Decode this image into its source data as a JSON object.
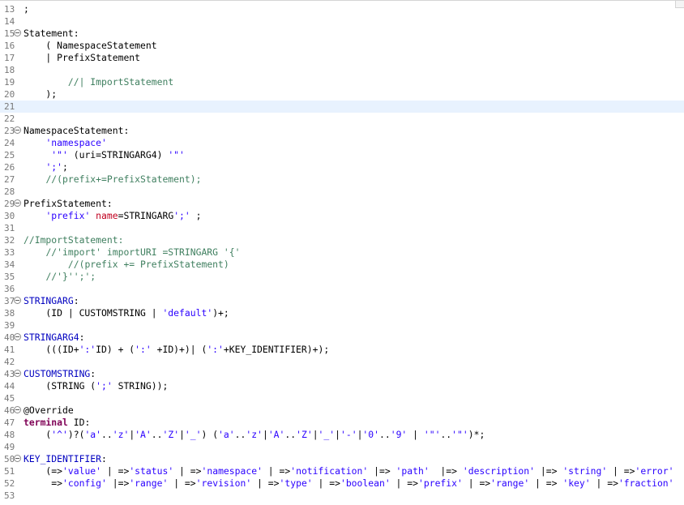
{
  "editor": {
    "colors": {
      "plain": "#000000",
      "string": "#2a00ff",
      "keyword": "#7f0055",
      "comment": "#3f7f5f",
      "cross_reference": "#c0001f",
      "rule_reference": "#0000c0",
      "current_line_background": "#e8f2fe"
    },
    "lines": [
      {
        "no": "13",
        "tokens": [
          {
            "t": "p",
            "v": ";"
          }
        ]
      },
      {
        "no": "14",
        "tokens": []
      },
      {
        "no": "15",
        "fold": true,
        "tokens": [
          {
            "t": "p",
            "v": "Statement:"
          }
        ]
      },
      {
        "no": "16",
        "tokens": [
          {
            "t": "p",
            "v": "    ( NamespaceStatement"
          }
        ]
      },
      {
        "no": "17",
        "tokens": [
          {
            "t": "p",
            "v": "    | PrefixStatement"
          }
        ]
      },
      {
        "no": "18",
        "tokens": []
      },
      {
        "no": "19",
        "tokens": [
          {
            "t": "p",
            "v": "        "
          },
          {
            "t": "c",
            "v": "//| ImportStatement"
          }
        ]
      },
      {
        "no": "20",
        "tokens": [
          {
            "t": "p",
            "v": "    );"
          }
        ]
      },
      {
        "no": "21",
        "current": true,
        "tokens": []
      },
      {
        "no": "22",
        "tokens": []
      },
      {
        "no": "23",
        "fold": true,
        "tokens": [
          {
            "t": "p",
            "v": "NamespaceStatement:"
          }
        ]
      },
      {
        "no": "24",
        "tokens": [
          {
            "t": "p",
            "v": "    "
          },
          {
            "t": "s",
            "v": "'namespace'"
          }
        ]
      },
      {
        "no": "25",
        "tokens": [
          {
            "t": "p",
            "v": "     "
          },
          {
            "t": "s",
            "v": "'\"'"
          },
          {
            "t": "p",
            "v": " (uri=STRINGARG4) "
          },
          {
            "t": "s",
            "v": "'\"'"
          }
        ]
      },
      {
        "no": "26",
        "tokens": [
          {
            "t": "p",
            "v": "    "
          },
          {
            "t": "s",
            "v": "';'"
          },
          {
            "t": "p",
            "v": ";"
          }
        ]
      },
      {
        "no": "27",
        "tokens": [
          {
            "t": "p",
            "v": "    "
          },
          {
            "t": "c",
            "v": "//(prefix+=PrefixStatement);"
          }
        ]
      },
      {
        "no": "28",
        "tokens": []
      },
      {
        "no": "29",
        "fold": true,
        "tokens": [
          {
            "t": "p",
            "v": "PrefixStatement:"
          }
        ]
      },
      {
        "no": "30",
        "tokens": [
          {
            "t": "p",
            "v": "    "
          },
          {
            "t": "s",
            "v": "'prefix'"
          },
          {
            "t": "p",
            "v": " "
          },
          {
            "t": "r",
            "v": "name"
          },
          {
            "t": "p",
            "v": "=STRINGARG"
          },
          {
            "t": "s",
            "v": "';'"
          },
          {
            "t": "p",
            "v": " ;"
          }
        ]
      },
      {
        "no": "31",
        "tokens": []
      },
      {
        "no": "32",
        "tokens": [
          {
            "t": "c",
            "v": "//ImportStatement:"
          }
        ]
      },
      {
        "no": "33",
        "tokens": [
          {
            "t": "p",
            "v": "    "
          },
          {
            "t": "c",
            "v": "//'import' importURI =STRINGARG '{'"
          }
        ]
      },
      {
        "no": "34",
        "tokens": [
          {
            "t": "p",
            "v": "        "
          },
          {
            "t": "c",
            "v": "//(prefix += PrefixStatement)"
          }
        ]
      },
      {
        "no": "35",
        "tokens": [
          {
            "t": "p",
            "v": "    "
          },
          {
            "t": "c",
            "v": "//'}'';';"
          }
        ]
      },
      {
        "no": "36",
        "tokens": []
      },
      {
        "no": "37",
        "fold": true,
        "tokens": [
          {
            "t": "f",
            "v": "STRINGARG"
          },
          {
            "t": "p",
            "v": ":"
          }
        ]
      },
      {
        "no": "38",
        "tokens": [
          {
            "t": "p",
            "v": "    (ID | CUSTOMSTRING | "
          },
          {
            "t": "s",
            "v": "'default'"
          },
          {
            "t": "p",
            "v": ")+;"
          }
        ]
      },
      {
        "no": "39",
        "tokens": []
      },
      {
        "no": "40",
        "fold": true,
        "tokens": [
          {
            "t": "f",
            "v": "STRINGARG4"
          },
          {
            "t": "p",
            "v": ":"
          }
        ]
      },
      {
        "no": "41",
        "tokens": [
          {
            "t": "p",
            "v": "    (((ID+"
          },
          {
            "t": "s",
            "v": "':'"
          },
          {
            "t": "p",
            "v": "ID) + ("
          },
          {
            "t": "s",
            "v": "':'"
          },
          {
            "t": "p",
            "v": " +ID)+)| ("
          },
          {
            "t": "s",
            "v": "':'"
          },
          {
            "t": "p",
            "v": "+KEY_IDENTIFIER)+);"
          }
        ]
      },
      {
        "no": "42",
        "tokens": []
      },
      {
        "no": "43",
        "fold": true,
        "tokens": [
          {
            "t": "f",
            "v": "CUSTOMSTRING"
          },
          {
            "t": "p",
            "v": ":"
          }
        ]
      },
      {
        "no": "44",
        "tokens": [
          {
            "t": "p",
            "v": "    (STRING ("
          },
          {
            "t": "s",
            "v": "';'"
          },
          {
            "t": "p",
            "v": " STRING));"
          }
        ]
      },
      {
        "no": "45",
        "tokens": []
      },
      {
        "no": "46",
        "fold": true,
        "tokens": [
          {
            "t": "p",
            "v": "@Override"
          }
        ]
      },
      {
        "no": "47",
        "tokens": [
          {
            "t": "k",
            "v": "terminal"
          },
          {
            "t": "p",
            "v": " ID:"
          }
        ]
      },
      {
        "no": "48",
        "tokens": [
          {
            "t": "p",
            "v": "    ("
          },
          {
            "t": "s",
            "v": "'^'"
          },
          {
            "t": "p",
            "v": ")?("
          },
          {
            "t": "s",
            "v": "'a'"
          },
          {
            "t": "p",
            "v": ".."
          },
          {
            "t": "s",
            "v": "'z'"
          },
          {
            "t": "p",
            "v": "|"
          },
          {
            "t": "s",
            "v": "'A'"
          },
          {
            "t": "p",
            "v": ".."
          },
          {
            "t": "s",
            "v": "'Z'"
          },
          {
            "t": "p",
            "v": "|"
          },
          {
            "t": "s",
            "v": "'_'"
          },
          {
            "t": "p",
            "v": ") ("
          },
          {
            "t": "s",
            "v": "'a'"
          },
          {
            "t": "p",
            "v": ".."
          },
          {
            "t": "s",
            "v": "'z'"
          },
          {
            "t": "p",
            "v": "|"
          },
          {
            "t": "s",
            "v": "'A'"
          },
          {
            "t": "p",
            "v": ".."
          },
          {
            "t": "s",
            "v": "'Z'"
          },
          {
            "t": "p",
            "v": "|"
          },
          {
            "t": "s",
            "v": "'_'"
          },
          {
            "t": "p",
            "v": "|"
          },
          {
            "t": "s",
            "v": "'-'"
          },
          {
            "t": "p",
            "v": "|"
          },
          {
            "t": "s",
            "v": "'0'"
          },
          {
            "t": "p",
            "v": ".."
          },
          {
            "t": "s",
            "v": "'9'"
          },
          {
            "t": "p",
            "v": " | "
          },
          {
            "t": "s",
            "v": "'\"'"
          },
          {
            "t": "p",
            "v": ".."
          },
          {
            "t": "s",
            "v": "'\"'"
          },
          {
            "t": "p",
            "v": ")*;"
          }
        ]
      },
      {
        "no": "49",
        "tokens": []
      },
      {
        "no": "50",
        "fold": true,
        "tokens": [
          {
            "t": "f",
            "v": "KEY_IDENTIFIER"
          },
          {
            "t": "p",
            "v": ":"
          }
        ]
      },
      {
        "no": "51",
        "tokens": [
          {
            "t": "p",
            "v": "    (=>"
          },
          {
            "t": "s",
            "v": "'value'"
          },
          {
            "t": "p",
            "v": " | =>"
          },
          {
            "t": "s",
            "v": "'status'"
          },
          {
            "t": "p",
            "v": " | =>"
          },
          {
            "t": "s",
            "v": "'namespace'"
          },
          {
            "t": "p",
            "v": " | =>"
          },
          {
            "t": "s",
            "v": "'notification'"
          },
          {
            "t": "p",
            "v": " |=> "
          },
          {
            "t": "s",
            "v": "'path'"
          },
          {
            "t": "p",
            "v": "  |=> "
          },
          {
            "t": "s",
            "v": "'description'"
          },
          {
            "t": "p",
            "v": " |=> "
          },
          {
            "t": "s",
            "v": "'string'"
          },
          {
            "t": "p",
            "v": " | =>"
          },
          {
            "t": "s",
            "v": "'error'"
          }
        ]
      },
      {
        "no": "52",
        "tokens": [
          {
            "t": "p",
            "v": "     =>"
          },
          {
            "t": "s",
            "v": "'config'"
          },
          {
            "t": "p",
            "v": " |=>"
          },
          {
            "t": "s",
            "v": "'range'"
          },
          {
            "t": "p",
            "v": " | =>"
          },
          {
            "t": "s",
            "v": "'revision'"
          },
          {
            "t": "p",
            "v": " | =>"
          },
          {
            "t": "s",
            "v": "'type'"
          },
          {
            "t": "p",
            "v": " | =>"
          },
          {
            "t": "s",
            "v": "'boolean'"
          },
          {
            "t": "p",
            "v": " | =>"
          },
          {
            "t": "s",
            "v": "'prefix'"
          },
          {
            "t": "p",
            "v": " | =>"
          },
          {
            "t": "s",
            "v": "'range'"
          },
          {
            "t": "p",
            "v": " | => "
          },
          {
            "t": "s",
            "v": "'key'"
          },
          {
            "t": "p",
            "v": " | =>"
          },
          {
            "t": "s",
            "v": "'fraction'"
          }
        ]
      },
      {
        "no": "53",
        "tokens": []
      }
    ]
  }
}
